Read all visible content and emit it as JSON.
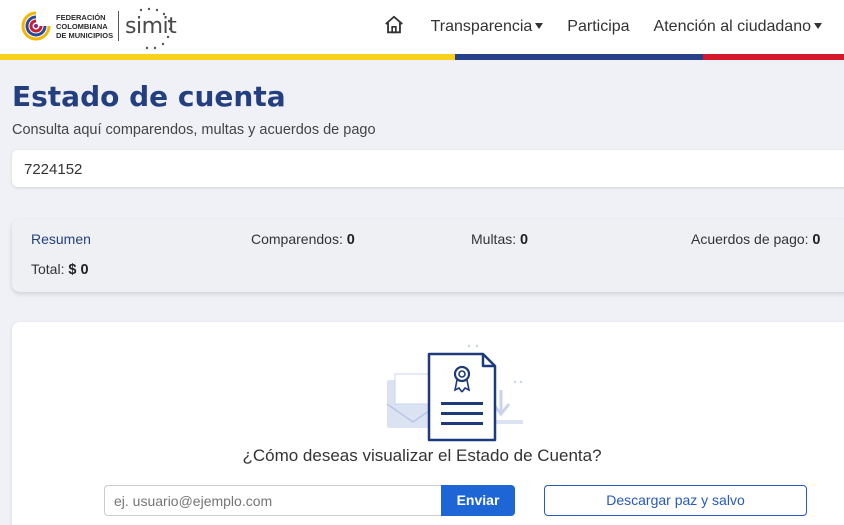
{
  "header": {
    "logo": {
      "fcm_line1": "FEDERACIÓN",
      "fcm_line2": "COLOMBIANA",
      "fcm_line3": "DE MUNICIPIOS",
      "simit": "simit"
    },
    "nav": {
      "home_icon": "home-icon",
      "items": [
        {
          "label": "Transparencia",
          "dropdown": true
        },
        {
          "label": "Participa",
          "dropdown": false
        },
        {
          "label": "Atención al ciudadano",
          "dropdown": true
        }
      ]
    },
    "stripe_colors": [
      "#f8d21a",
      "#26408a",
      "#d41a2b"
    ]
  },
  "main": {
    "title": "Estado de cuenta",
    "subtitle": "Consulta aquí comparendos, multas y acuerdos de pago",
    "search_value": "7224152"
  },
  "summary": {
    "label": "Resumen",
    "comparendos_label": "Comparendos:",
    "comparendos_value": "0",
    "multas_label": "Multas:",
    "multas_value": "0",
    "acuerdos_label": "Acuerdos de pago:",
    "acuerdos_value": "0",
    "total_label": "Total:",
    "total_value": "$ 0"
  },
  "panel": {
    "illustration_icon": "certificate-document-icon",
    "question": "¿Cómo deseas visualizar el Estado de Cuenta?",
    "email_placeholder": "ej. usuario@ejemplo.com",
    "send_label": "Enviar",
    "download_label": "Descargar paz y salvo"
  },
  "colors": {
    "accent": "#243f80",
    "button": "#1e66d6"
  }
}
